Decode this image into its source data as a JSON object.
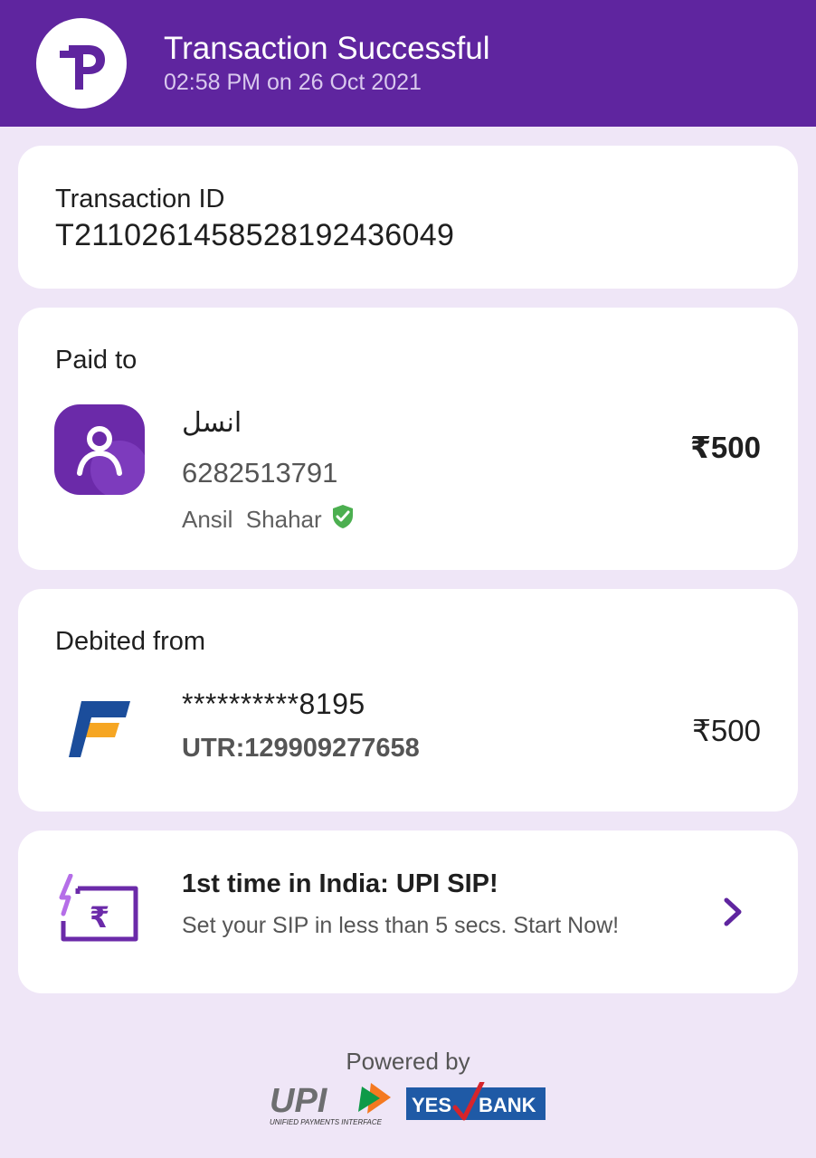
{
  "header": {
    "title": "Transaction Successful",
    "subtitle": "02:58 PM on 26 Oct 2021",
    "logo_icon": "phonepe-logo-icon",
    "bg_color": "#5f259f"
  },
  "transaction": {
    "label": "Transaction ID",
    "id": "T2110261458528192436049"
  },
  "paid_to": {
    "label": "Paid to",
    "name": "انسل",
    "phone": "6282513791",
    "verified_name": "Ansil  Shahar",
    "amount": "₹500",
    "avatar_icon": "person-icon",
    "verified_icon": "verified-shield-icon"
  },
  "debited_from": {
    "label": "Debited from",
    "account": "**********8195",
    "utr": "UTR:129909277658",
    "amount": "₹500",
    "bank_icon": "bank-logo-icon"
  },
  "promo": {
    "title": "1st time in India: UPI SIP!",
    "subtitle": "Set your SIP in less than 5 secs. Start Now!",
    "icon": "sip-rupee-icon"
  },
  "footer": {
    "powered_by": "Powered by",
    "upi_logo_text": "UPI",
    "upi_tagline": "UNIFIED PAYMENTS INTERFACE",
    "bank_logo_text_1": "YES",
    "bank_logo_text_2": "BANK"
  },
  "colors": {
    "accent": "#5f259f",
    "background": "#efe6f7",
    "verified_green": "#4caf50"
  }
}
